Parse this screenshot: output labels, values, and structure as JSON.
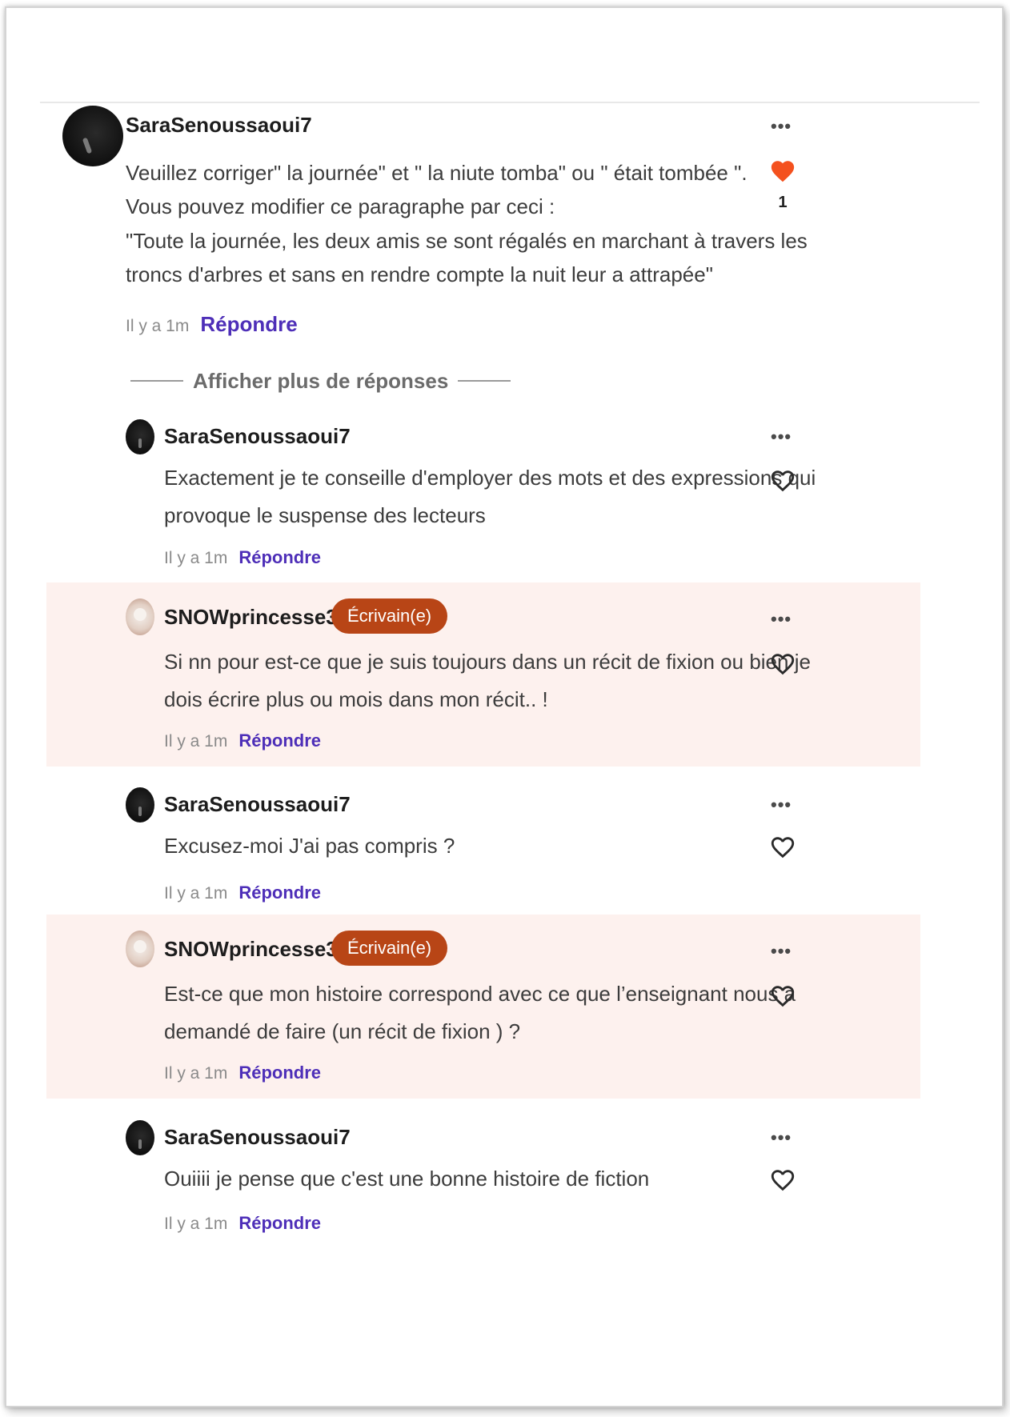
{
  "main_comment": {
    "username": "SaraSenoussaoui7",
    "text_lines": [
      "Veuillez corriger\" la journée\" et \" la niute tomba\" ou \" était tombée \".",
      "Vous pouvez modifier ce paragraphe par ceci :",
      "\"Toute la journée, les deux amis se sont régalés en marchant à travers les",
      "troncs d'arbres et sans en rendre compte la nuit leur a attrapée\""
    ],
    "time": "Il y a 1m",
    "reply_label": "Répondre",
    "more_label": "•••",
    "likes": "1",
    "liked": true,
    "heart_color": "#f4511e"
  },
  "show_more_label": "Afficher plus de réponses",
  "replies": [
    {
      "username": "SaraSenoussaoui7",
      "badge": "",
      "text": "Exactement je te conseille d'employer des mots et des expressions qui\nprovoque le suspense des lecteurs",
      "time": "Il y a 1m",
      "reply_label": "Répondre",
      "more_label": "•••"
    },
    {
      "username": "SNOWprincesse360",
      "badge": "Écrivain(e)",
      "text": "Si nn pour est-ce que je suis toujours dans un récit de fixion ou bien je\ndois écrire plus ou mois dans mon récit.. !",
      "time": "Il y a 1m",
      "reply_label": "Répondre",
      "more_label": "•••"
    },
    {
      "username": "SaraSenoussaoui7",
      "badge": "",
      "text": "Excusez-moi J'ai pas compris ?",
      "time": "Il y a 1m",
      "reply_label": "Répondre",
      "more_label": "•••"
    },
    {
      "username": "SNOWprincesse360",
      "badge": "Écrivain(e)",
      "text": "Est-ce que mon histoire correspond avec ce que l’enseignant nous a\ndemandé de faire (un récit de fixion ) ?",
      "time": "Il y a 1m",
      "reply_label": "Répondre",
      "more_label": "•••"
    },
    {
      "username": "SaraSenoussaoui7",
      "badge": "",
      "text": "Ouiiii je pense que c'est une bonne histoire de fiction",
      "time": "Il y a 1m",
      "reply_label": "Répondre",
      "more_label": "•••"
    }
  ],
  "colors": {
    "author_highlight": "#fdf1ee",
    "badge": "#b84516",
    "reply_link": "#4e2fb8"
  }
}
